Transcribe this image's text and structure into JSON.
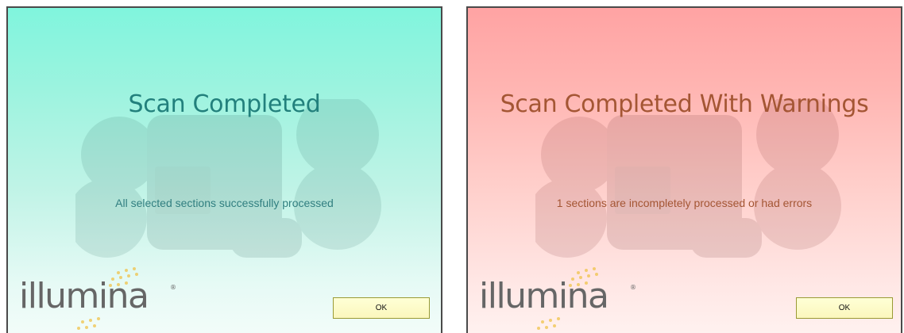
{
  "dialogs": [
    {
      "variant": "success",
      "title": "Scan Completed",
      "message": "All selected sections successfully processed",
      "ok_label": "OK",
      "colors": {
        "background_top": "#80f5dd",
        "text": "#22807c"
      }
    },
    {
      "variant": "warning",
      "title": "Scan Completed With Warnings",
      "message": "1 sections are incompletely processed or had errors",
      "ok_label": "OK",
      "colors": {
        "background_top": "#ffa3a3",
        "text": "#a45634"
      }
    }
  ],
  "logo": {
    "text": "illumina",
    "mark": "®"
  },
  "icons": {
    "watermark": "scanner-instrument-watermark",
    "logo_dots": "illumina-dots-icon"
  }
}
